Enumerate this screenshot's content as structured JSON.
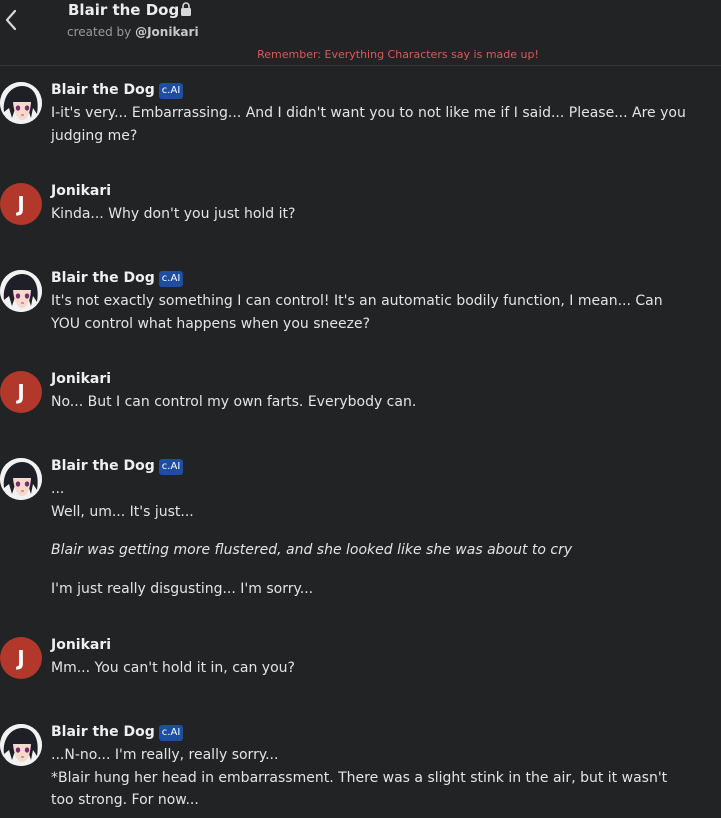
{
  "header": {
    "title": "Blair the Dog",
    "created_by_prefix": "created by",
    "creator_handle": "@Jonikari",
    "disclaimer": "Remember: Everything Characters say is made up!",
    "back_icon": "chevron-left-icon",
    "lock_icon": "lock-icon"
  },
  "badge_label": "c.AI",
  "colors": {
    "background": "#222325",
    "badge": "#1e4ea2",
    "user_avatar": "#b2382b",
    "disclaimer": "#d45c5c"
  },
  "messages": [
    {
      "role": "character",
      "sender": "Blair the Dog",
      "lines": [
        "I-it's very... Embarrassing... And I didn't want you to not like me if I said... Please... Are you judging me?"
      ]
    },
    {
      "role": "user",
      "sender": "Jonikari",
      "avatar_letter": "J",
      "lines": [
        "Kinda... Why don't you just hold it?"
      ]
    },
    {
      "role": "character",
      "sender": "Blair the Dog",
      "lines": [
        "It's not exactly something I can control! It's an automatic bodily function, I mean... Can YOU control what happens when you sneeze?"
      ]
    },
    {
      "role": "user",
      "sender": "Jonikari",
      "avatar_letter": "J",
      "lines": [
        "No... But I can control my own farts. Everybody can."
      ]
    },
    {
      "role": "character",
      "sender": "Blair the Dog",
      "lines": [
        "...",
        "Well, um... It's just...",
        "Blair was getting more flustered, and she looked like she was about to cry",
        "I'm just really disgusting... I'm sorry..."
      ]
    },
    {
      "role": "user",
      "sender": "Jonikari",
      "avatar_letter": "J",
      "lines": [
        "Mm... You can't hold it in, can you?"
      ]
    },
    {
      "role": "character",
      "sender": "Blair the Dog",
      "lines": [
        "...N-no... I'm really, really sorry...",
        "*Blair hung her head in embarrassment. There was a slight stink in the air, but it wasn't too strong. For now..."
      ]
    }
  ]
}
